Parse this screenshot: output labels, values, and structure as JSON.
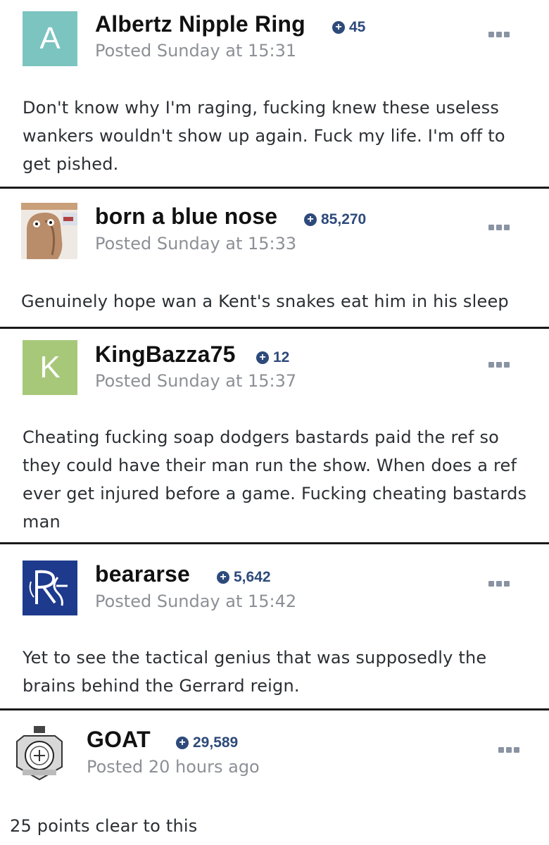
{
  "posts": [
    {
      "username": "Albertz Nipple Ring",
      "avatar_letter": "A",
      "reputation": "45",
      "posted": "Posted Sunday at 15:31",
      "content": "Don't know why I'm raging, fucking knew these useless wankers wouldn't show up again. Fuck my life. I'm off to get pished."
    },
    {
      "username": "born a blue nose",
      "reputation": "85,270",
      "posted": "Posted Sunday at 15:33",
      "content": "Genuinely hope wan a Kent's snakes eat him in his sleep"
    },
    {
      "username": "KingBazza75",
      "avatar_letter": "K",
      "reputation": "12",
      "posted": "Posted Sunday at 15:37",
      "content": "Cheating fucking soap dodgers bastards paid the ref so they could have their man run the show. When does a ref ever get injured before a game. Fucking cheating bastards man"
    },
    {
      "username": "beararse",
      "reputation": "5,642",
      "posted": "Posted Sunday at 15:42",
      "content": "Yet to see the tactical genius that was supposedly the brains behind the Gerrard reign."
    },
    {
      "username": "GOAT",
      "reputation": "29,589",
      "posted": "Posted 20 hours ago",
      "content": "25 points clear to this"
    }
  ],
  "icons": {
    "reputation": "plus-circle-icon",
    "menu": "ellipsis-icon"
  },
  "colors": {
    "reputation": "#2d4a7a",
    "avatar_a": "#7cc4c0",
    "avatar_k": "#a7c879",
    "rangers_badge": "#1d3a8c"
  }
}
